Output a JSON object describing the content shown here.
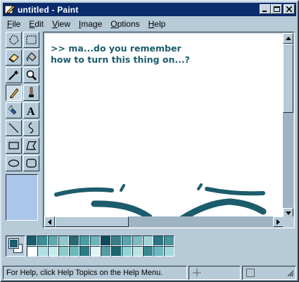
{
  "window": {
    "title": "untitled - Paint",
    "title_color": "#0a2b6c",
    "controls": {
      "minimize": "minimize-icon",
      "maximize": "maximize-icon",
      "close": "close-icon"
    }
  },
  "menu": [
    "File",
    "Edit",
    "View",
    "Image",
    "Options",
    "Help"
  ],
  "tools": [
    {
      "name": "free-form-select-icon"
    },
    {
      "name": "select-icon"
    },
    {
      "name": "eraser-icon"
    },
    {
      "name": "fill-bucket-icon"
    },
    {
      "name": "color-picker-icon"
    },
    {
      "name": "magnifier-icon"
    },
    {
      "name": "pencil-icon",
      "selected": true
    },
    {
      "name": "brush-icon"
    },
    {
      "name": "airbrush-icon"
    },
    {
      "name": "text-icon"
    },
    {
      "name": "line-icon"
    },
    {
      "name": "curve-icon"
    },
    {
      "name": "rectangle-icon"
    },
    {
      "name": "polygon-icon"
    },
    {
      "name": "ellipse-icon"
    },
    {
      "name": "rounded-rectangle-icon"
    }
  ],
  "canvas": {
    "text": ">> ma...do you remember\nhow to turn this thing on...?",
    "drawing_color": "#1c5c6c"
  },
  "colors": {
    "foreground": "#1c5c6c",
    "background": "#ffffff",
    "palette": [
      "#1c5c6c",
      "#3c8c94",
      "#5ea8b0",
      "#8cc8cc",
      "#2a6874",
      "#4c9ca4",
      "#6cb4bc",
      "#0e4c5c",
      "#3a7c88",
      "#5aa4ac",
      "#7cbcc4",
      "#9ed4d8",
      "#2e7480",
      "#4a94a0",
      "#ffffff",
      "#aee0e0",
      "#c4ecec",
      "#88cccc",
      "#6ab8bc",
      "#2c7c84",
      "#dff4f4",
      "#549ca4",
      "#1a6470",
      "#90d4d4",
      "#b8e4e4",
      "#3c8890",
      "#6cb8c0",
      "#a0d8dc"
    ]
  },
  "status": {
    "help": "For Help, click Help Topics on the Help Menu."
  }
}
